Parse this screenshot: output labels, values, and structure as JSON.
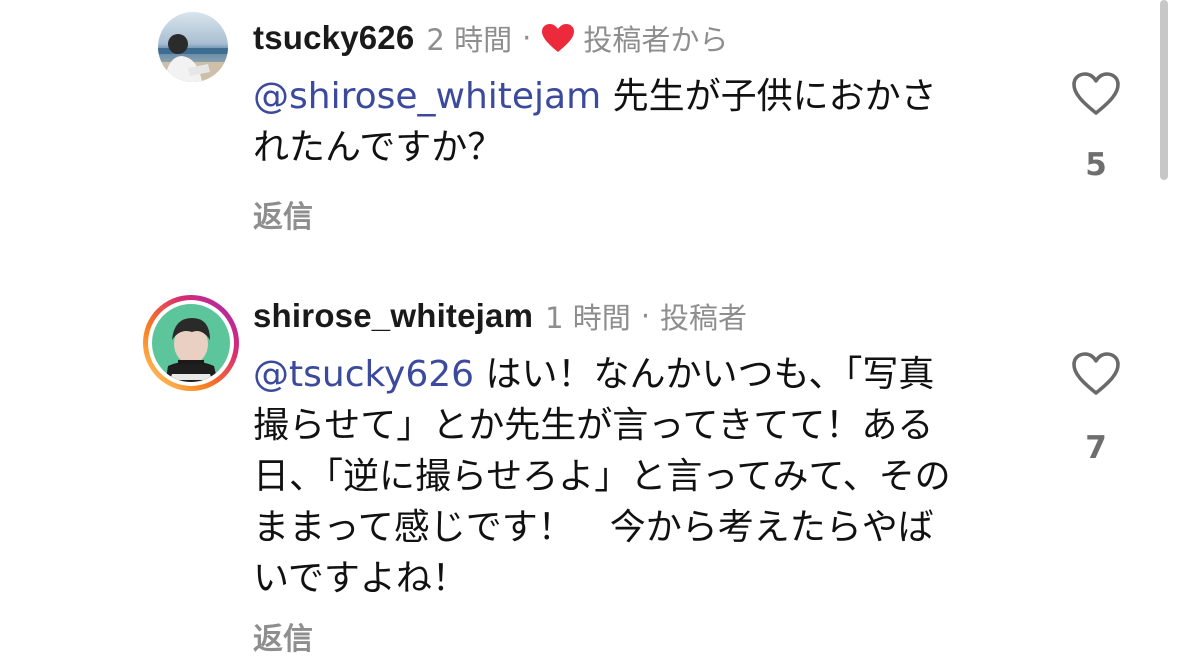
{
  "comments": [
    {
      "username": "tsucky626",
      "time": "2 時間",
      "separator": "·",
      "badge": "投稿者から",
      "mention": "@shirose_whitejam",
      "text_line1": " 先生が子供におかさ",
      "text_rest": "れたんですか？",
      "reply_label": "返信",
      "like_count": "5",
      "liked_by_author": true
    },
    {
      "username": "shirose_whitejam",
      "time": "1 時間",
      "separator": "·",
      "badge": "投稿者",
      "mention": "@tsucky626",
      "text_line1": " はい！なんかいつも、「写真",
      "text_rest": "撮らせて」とか先生が言ってきてて！ある\n日、「逆に撮らせろよ」と言ってみて、その\nままって感じです！　今から考えたらやば\nいですよね！",
      "reply_label": "返信",
      "like_count": "7",
      "liked_by_author": false
    }
  ],
  "colors": {
    "mention": "#3b4a9c",
    "heart_red": "#ed2a3b",
    "meta_grey": "#8e8e8e",
    "story_ring_start": "#feda75",
    "story_ring_end": "#d62976"
  },
  "icons": {
    "like": "heart-outline-icon",
    "author_like": "heart-filled-icon"
  }
}
